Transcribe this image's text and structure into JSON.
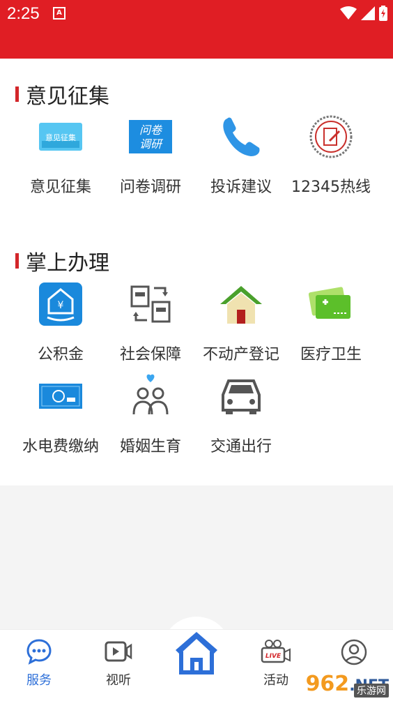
{
  "status": {
    "time": "2:25",
    "notif": "A"
  },
  "sections": [
    {
      "title": "意见征集",
      "items": [
        {
          "label": "意见征集",
          "icon": "opinion-banner-icon"
        },
        {
          "label": "问卷调研",
          "icon": "survey-banner-icon"
        },
        {
          "label": "投诉建议",
          "icon": "phone-icon"
        },
        {
          "label": "12345热线",
          "icon": "edit-note-icon"
        }
      ]
    },
    {
      "title": "掌上办理",
      "items": [
        {
          "label": "公积金",
          "icon": "housing-fund-icon"
        },
        {
          "label": "社会保障",
          "icon": "social-security-icon"
        },
        {
          "label": "不动产登记",
          "icon": "house-icon"
        },
        {
          "label": "医疗卫生",
          "icon": "medical-card-icon"
        },
        {
          "label": "水电费缴纳",
          "icon": "utility-card-icon"
        },
        {
          "label": "婚姻生育",
          "icon": "family-icon"
        },
        {
          "label": "交通出行",
          "icon": "car-icon"
        }
      ]
    }
  ],
  "opinion_banner_text": "意见征集",
  "survey_banner_text": [
    "问卷",
    "调研"
  ],
  "tabs": [
    {
      "label": "服务",
      "icon": "chat-icon",
      "active": true
    },
    {
      "label": "视听",
      "icon": "video-icon",
      "active": false
    },
    {
      "label": "",
      "icon": "home-icon",
      "active": false
    },
    {
      "label": "活动",
      "icon": "live-camera-icon",
      "active": false
    },
    {
      "label": "",
      "icon": "user-icon",
      "active": false
    }
  ],
  "live_badge": "LIVE",
  "watermark": {
    "brand": "962",
    "net": ".NET",
    "sub": "乐游网"
  },
  "colors": {
    "brand_red": "#e01e24",
    "accent_blue": "#2d6fd8",
    "title_bar": "#d3262a"
  }
}
